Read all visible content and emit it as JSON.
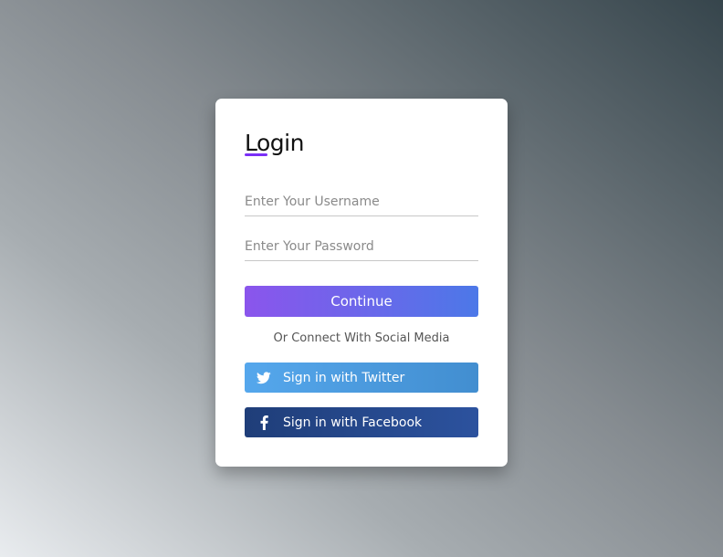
{
  "login": {
    "title": "Login",
    "username_placeholder": "Enter Your Username",
    "password_placeholder": "Enter Your Password",
    "continue_label": "Continue",
    "social_prompt": "Or Connect With Social Media",
    "twitter_label": "Sign in with Twitter",
    "facebook_label": "Sign in with Facebook",
    "twitter_icon": "twitter-icon",
    "facebook_icon": "facebook-icon"
  },
  "colors": {
    "accent": "#7b2ff7",
    "continue_gradient_start": "#8b55ec",
    "continue_gradient_end": "#4c78e8",
    "twitter": "#4a9be0",
    "facebook": "#26478b",
    "card_background": "#ffffff"
  }
}
